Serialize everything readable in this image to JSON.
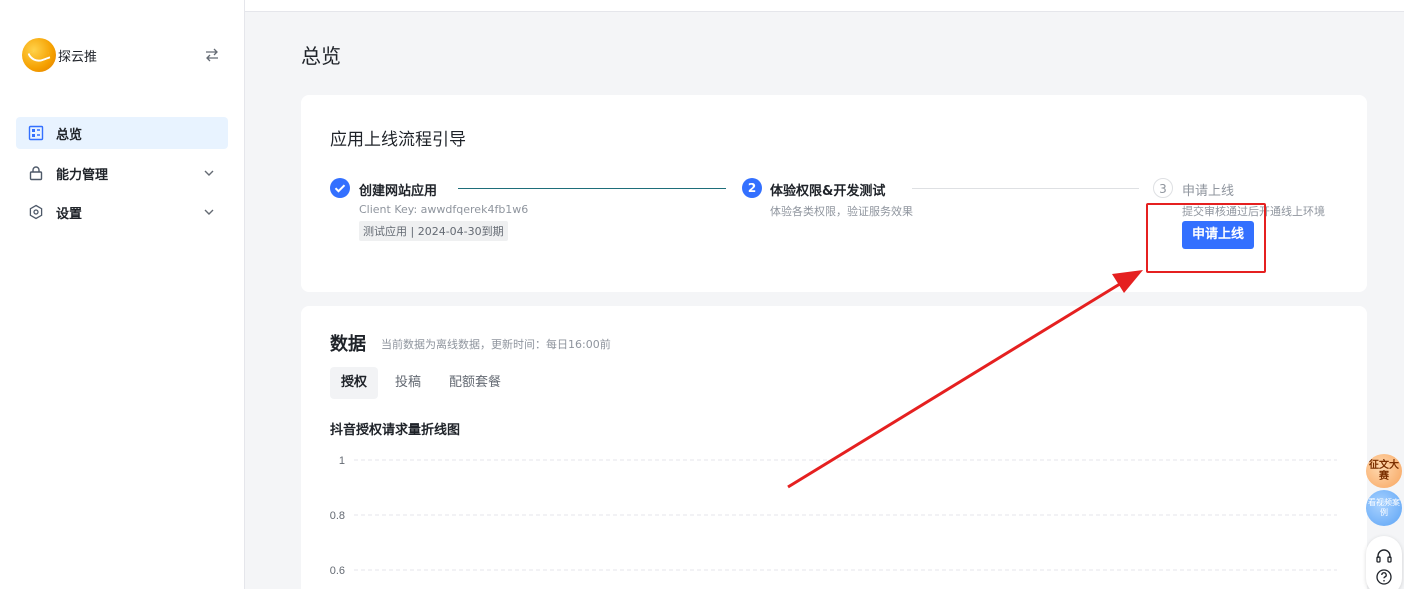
{
  "brand": {
    "name": "探云推",
    "logo_icon": "app-logo"
  },
  "sidebar": {
    "items": [
      {
        "label": "总览",
        "icon": "dashboard-icon",
        "active": true
      },
      {
        "label": "能力管理",
        "icon": "lock-icon",
        "expandable": true
      },
      {
        "label": "设置",
        "icon": "settings-icon",
        "expandable": true
      }
    ]
  },
  "page": {
    "title": "总览"
  },
  "guide": {
    "title": "应用上线流程引导",
    "steps": [
      {
        "index": "✓",
        "title": "创建网站应用",
        "desc": "Client Key: awwdfqerek4fb1w6",
        "tag": "测试应用 | 2024-04-30到期",
        "state": "done"
      },
      {
        "index": "2",
        "title": "体验权限&开发测试",
        "desc": "体验各类权限，验证服务效果",
        "state": "active"
      },
      {
        "index": "3",
        "title": "申请上线",
        "desc": "提交审核通过后开通线上环境",
        "state": "pending"
      }
    ],
    "apply_button": "申请上线"
  },
  "data_section": {
    "title": "数据",
    "subtitle": "当前数据为离线数据，更新时间：每日16:00前",
    "tabs": [
      {
        "label": "授权",
        "active": true
      },
      {
        "label": "投稿"
      },
      {
        "label": "配额套餐"
      }
    ],
    "chart_title": "抖音授权请求量折线图"
  },
  "chart_data": {
    "type": "line",
    "title": "抖音授权请求量折线图",
    "y_ticks": [
      "1",
      "0.8",
      "0.6"
    ],
    "ylim": [
      0.6,
      1
    ],
    "grid": true,
    "series": []
  },
  "floating": {
    "contest_label": "征文大赛",
    "case_label": "看视频案例"
  },
  "colors": {
    "primary": "#3370ff",
    "annotation": "#e52020"
  }
}
